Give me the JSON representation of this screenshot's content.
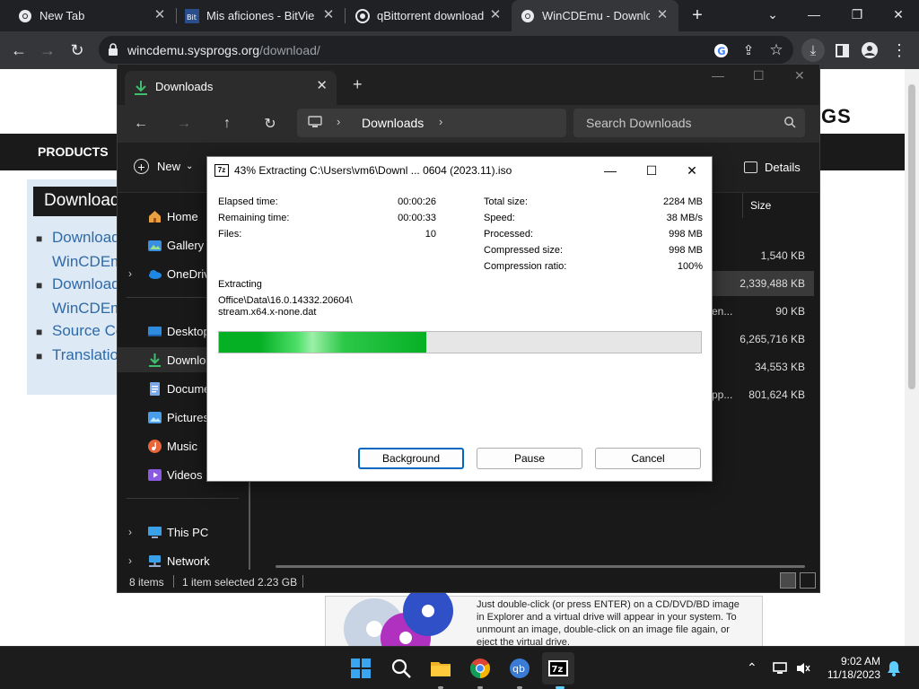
{
  "browser": {
    "tabs": [
      {
        "title": "New Tab",
        "icon": "chrome-icon"
      },
      {
        "title": "Mis aficiones - BitView",
        "icon": "bitview-icon"
      },
      {
        "title": "qBittorrent download |",
        "icon": "github-icon"
      },
      {
        "title": "WinCDEmu - Downloa",
        "icon": "chrome-icon",
        "active": true
      }
    ],
    "url_host": "wincdemu.sysprogs.org",
    "url_path": "/download/"
  },
  "webpage": {
    "logo_fragment": "GS",
    "nav_products": "PRODUCTS",
    "sidebar_heading": "Download",
    "links": [
      "Download",
      "WinCDEm",
      "Download",
      "WinCDEm",
      "Source Co",
      "Translatio"
    ],
    "bottom_text": "Just double-click (or press ENTER) on a CD/DVD/BD image in Explorer and a virtual drive will appear in your system. To unmount an image, double-click on an image file again, or eject the virtual drive."
  },
  "explorer": {
    "tab_title": "Downloads",
    "breadcrumb": "Downloads",
    "search_placeholder": "Search Downloads",
    "new_label": "New",
    "details_label": "Details",
    "nav_items": [
      {
        "label": "Home",
        "icon": "home-icon"
      },
      {
        "label": "Gallery",
        "icon": "gallery-icon"
      },
      {
        "label": "OneDrive",
        "icon": "onedrive-icon"
      },
      {
        "label": "Desktop",
        "icon": "desktop-icon"
      },
      {
        "label": "Downloads",
        "icon": "downloads-icon"
      },
      {
        "label": "Documents",
        "icon": "documents-icon"
      },
      {
        "label": "Pictures",
        "icon": "pictures-icon"
      },
      {
        "label": "Music",
        "icon": "music-icon"
      },
      {
        "label": "Videos",
        "icon": "videos-icon"
      },
      {
        "label": "This PC",
        "icon": "this-pc-icon"
      },
      {
        "label": "Network",
        "icon": "network-icon"
      }
    ],
    "size_header": "Size",
    "rows": [
      {
        "trunc": "",
        "size": "1,540 KB"
      },
      {
        "trunc": "",
        "size": "2,339,488 KB",
        "selected": true
      },
      {
        "trunc": "en...",
        "size": "90 KB"
      },
      {
        "trunc": "",
        "size": "6,265,716 KB"
      },
      {
        "trunc": "",
        "size": "34,553 KB"
      },
      {
        "trunc": "pp...",
        "size": "801,624 KB"
      }
    ],
    "status_items": "8 items",
    "status_selected": "1 item selected  2.23 GB"
  },
  "zip": {
    "title": "43% Extracting C:\\Users\\vm6\\Downl ... 0604 (2023.11).iso",
    "left_stats": [
      {
        "label": "Elapsed time:",
        "value": "00:00:26"
      },
      {
        "label": "Remaining time:",
        "value": "00:00:33"
      },
      {
        "label": "Files:",
        "value": "10"
      }
    ],
    "right_stats": [
      {
        "label": "Total size:",
        "value": "2284 MB"
      },
      {
        "label": "Speed:",
        "value": "38 MB/s"
      },
      {
        "label": "Processed:",
        "value": "998 MB"
      },
      {
        "label": "Compressed size:",
        "value": "998 MB"
      },
      {
        "label": "Compression ratio:",
        "value": "100%"
      }
    ],
    "extracting_label": "Extracting",
    "current_file_line1": "Office\\Data\\16.0.14332.20604\\",
    "current_file_line2": "stream.x64.x-none.dat",
    "progress_percent": 43,
    "buttons": {
      "background": "Background",
      "pause": "Pause",
      "cancel": "Cancel"
    }
  },
  "taskbar": {
    "time": "9:02 AM",
    "date": "11/18/2023"
  }
}
